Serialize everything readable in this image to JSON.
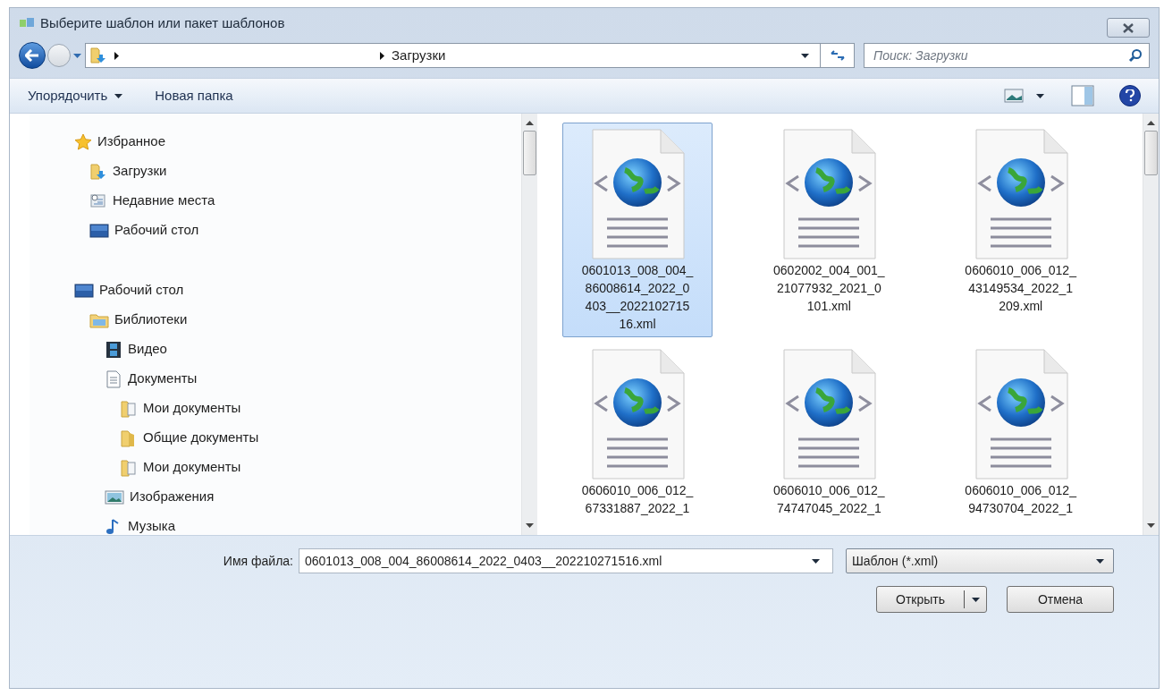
{
  "window": {
    "title": "Выберите шаблон или пакет шаблонов"
  },
  "address_bar": {
    "path": [
      "Загрузки"
    ]
  },
  "search": {
    "placeholder": "Поиск: Загрузки"
  },
  "toolbar": {
    "buttons": [
      {
        "label": "Упорядочить",
        "dropdown": true
      },
      {
        "label": "Новая папка",
        "dropdown": false
      }
    ]
  },
  "navigation": [
    {
      "label": "Избранное",
      "kind": "favorites",
      "children": [
        {
          "label": "Загрузки",
          "kind": "downloads"
        },
        {
          "label": "Недавние места",
          "kind": "recent"
        },
        {
          "label": "Рабочий стол",
          "kind": "desktop"
        }
      ]
    },
    {
      "label": "Рабочий стол",
      "kind": "desktop",
      "children": [
        {
          "label": "Библиотеки",
          "kind": "libraries",
          "children": [
            {
              "label": "Видео",
              "kind": "video"
            },
            {
              "label": "Документы",
              "kind": "documents",
              "children": [
                {
                  "label": "Мои документы",
                  "kind": "docfolder"
                },
                {
                  "label": "Общие документы",
                  "kind": "folder"
                },
                {
                  "label": "Мои документы",
                  "kind": "docfolder"
                }
              ]
            },
            {
              "label": "Изображения",
              "kind": "pictures"
            },
            {
              "label": "Музыка",
              "kind": "music"
            }
          ]
        }
      ]
    }
  ],
  "files": [
    {
      "name_lines": [
        "0601013_008_004_",
        "86008614_2022_0",
        "403__2022102715",
        "16.xml"
      ],
      "selected": true
    },
    {
      "name_lines": [
        "0602002_004_001_",
        "21077932_2021_0",
        "101.xml"
      ],
      "selected": false
    },
    {
      "name_lines": [
        "0606010_006_012_",
        "43149534_2022_1",
        "209.xml"
      ],
      "selected": false
    },
    {
      "name_lines": [
        "0606010_006_012_",
        "67331887_2022_1"
      ],
      "selected": false
    },
    {
      "name_lines": [
        "0606010_006_012_",
        "74747045_2022_1"
      ],
      "selected": false
    },
    {
      "name_lines": [
        "0606010_006_012_",
        "94730704_2022_1"
      ],
      "selected": false
    }
  ],
  "footer": {
    "filename_label": "Имя файла:",
    "filename_value": "0601013_008_004_86008614_2022_0403__202210271516.xml",
    "filter": "Шаблон (*.xml)",
    "open_button": "Открыть",
    "cancel_button": "Отмена"
  }
}
